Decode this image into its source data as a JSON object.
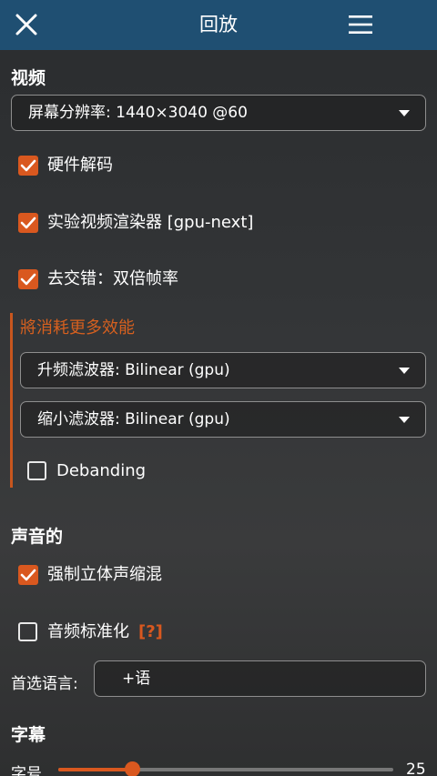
{
  "header": {
    "title": "回放",
    "close_icon": "close-icon",
    "menu_icon": "hamburger-menu-icon",
    "bg_color": "#1f4f72"
  },
  "video": {
    "section_title": "视频",
    "display_resolution": "屏幕分辨率: 1440×3040 @60",
    "hw_decode": {
      "label": "硬件解码",
      "checked": true
    },
    "experimental_renderer": {
      "label": "实验视频渲染器 [gpu-next]",
      "checked": true
    },
    "deinterlace": {
      "label": "去交错：双倍帧率",
      "checked": true
    },
    "performance_group": {
      "title": "將消耗更多效能",
      "upscale_filter": "升频滤波器: Bilinear (gpu)",
      "downscale_filter": "缩小滤波器: Bilinear (gpu)",
      "debanding": {
        "label": "Debanding",
        "checked": false
      }
    }
  },
  "audio": {
    "section_title": "声音的",
    "stereo_downmix": {
      "label": "强制立体声缩混",
      "checked": true
    },
    "normalize": {
      "label": "音频标准化",
      "checked": false,
      "help": "[?]"
    },
    "preferred_language": {
      "label": "首选语言:",
      "value": "+语"
    }
  },
  "subtitles": {
    "section_title": "字幕",
    "font_size": {
      "label": "字号",
      "value": "25",
      "fraction": 0.22
    }
  },
  "accent_color": "#d9581f"
}
